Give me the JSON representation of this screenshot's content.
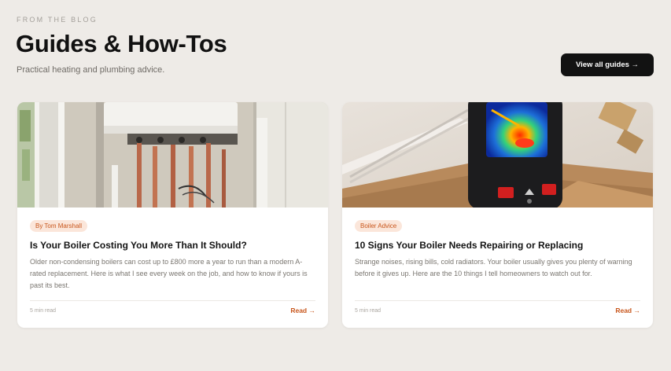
{
  "section": {
    "eyebrow": "FROM THE BLOG",
    "title": "Guides & How-Tos",
    "subtitle": "Practical heating and plumbing advice.",
    "view_all_label": "View all guides →"
  },
  "articles": [
    {
      "tag": "By Tom Marshall",
      "title": "Is Your Boiler Costing You More Than It Should?",
      "excerpt": "Older non-condensing boilers can cost up to £800 more a year to run than a modern A-rated replacement. Here is what I see every week on the job, and how to know if yours is past its best.",
      "read_time": "5 min read",
      "read_label": "Read →",
      "image": "boiler-installation-photo"
    },
    {
      "tag": "Boiler Advice",
      "title": "10 Signs Your Boiler Needs Repairing or Replacing",
      "excerpt": "Strange noises, rising bills, cold radiators. Your boiler usually gives you plenty of warning before it gives up. Here are the 10 things I tell homeowners to watch out for.",
      "read_time": "5 min read",
      "read_label": "Read →",
      "image": "thermal-camera-photo"
    }
  ],
  "colors": {
    "background": "#eeebe7",
    "accent": "#c8561c",
    "tag_background": "#fbe6da",
    "button_background": "#121212"
  }
}
